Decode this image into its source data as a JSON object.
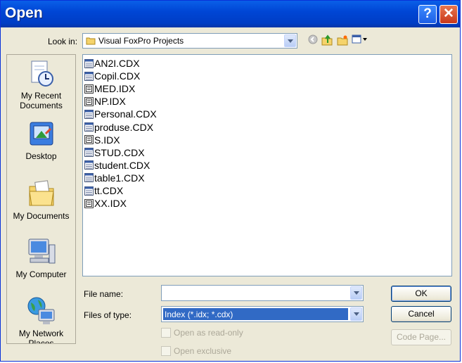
{
  "window": {
    "title": "Open"
  },
  "titlebar": {
    "help_label": "?",
    "close_label": "✕"
  },
  "lookin": {
    "label": "Look in:",
    "value": "Visual FoxPro Projects"
  },
  "places": [
    {
      "label": "My Recent Documents",
      "icon": "recent-documents-icon"
    },
    {
      "label": "Desktop",
      "icon": "desktop-icon"
    },
    {
      "label": "My Documents",
      "icon": "my-documents-icon"
    },
    {
      "label": "My Computer",
      "icon": "my-computer-icon"
    },
    {
      "label": "My Network Places",
      "icon": "network-places-icon"
    }
  ],
  "files": [
    {
      "name": "AN2I.CDX",
      "type": "cdx"
    },
    {
      "name": "Copil.CDX",
      "type": "cdx"
    },
    {
      "name": "MED.IDX",
      "type": "idx"
    },
    {
      "name": "NP.IDX",
      "type": "idx"
    },
    {
      "name": "Personal.CDX",
      "type": "cdx"
    },
    {
      "name": "produse.CDX",
      "type": "cdx"
    },
    {
      "name": "S.IDX",
      "type": "idx"
    },
    {
      "name": "STUD.CDX",
      "type": "cdx"
    },
    {
      "name": "student.CDX",
      "type": "cdx"
    },
    {
      "name": "table1.CDX",
      "type": "cdx"
    },
    {
      "name": "tt.CDX",
      "type": "cdx"
    },
    {
      "name": "XX.IDX",
      "type": "idx"
    }
  ],
  "filename": {
    "label": "File name:",
    "value": ""
  },
  "filetype": {
    "label": "Files of type:",
    "value": "Index (*.idx; *.cdx)"
  },
  "options": {
    "readonly_label": "Open as read-only",
    "exclusive_label": "Open exclusive"
  },
  "buttons": {
    "ok": "OK",
    "cancel": "Cancel",
    "codepage": "Code Page..."
  },
  "colors": {
    "titlebar": "#0046d5",
    "selection": "#316ac5",
    "dialog_bg": "#ece9d8"
  }
}
